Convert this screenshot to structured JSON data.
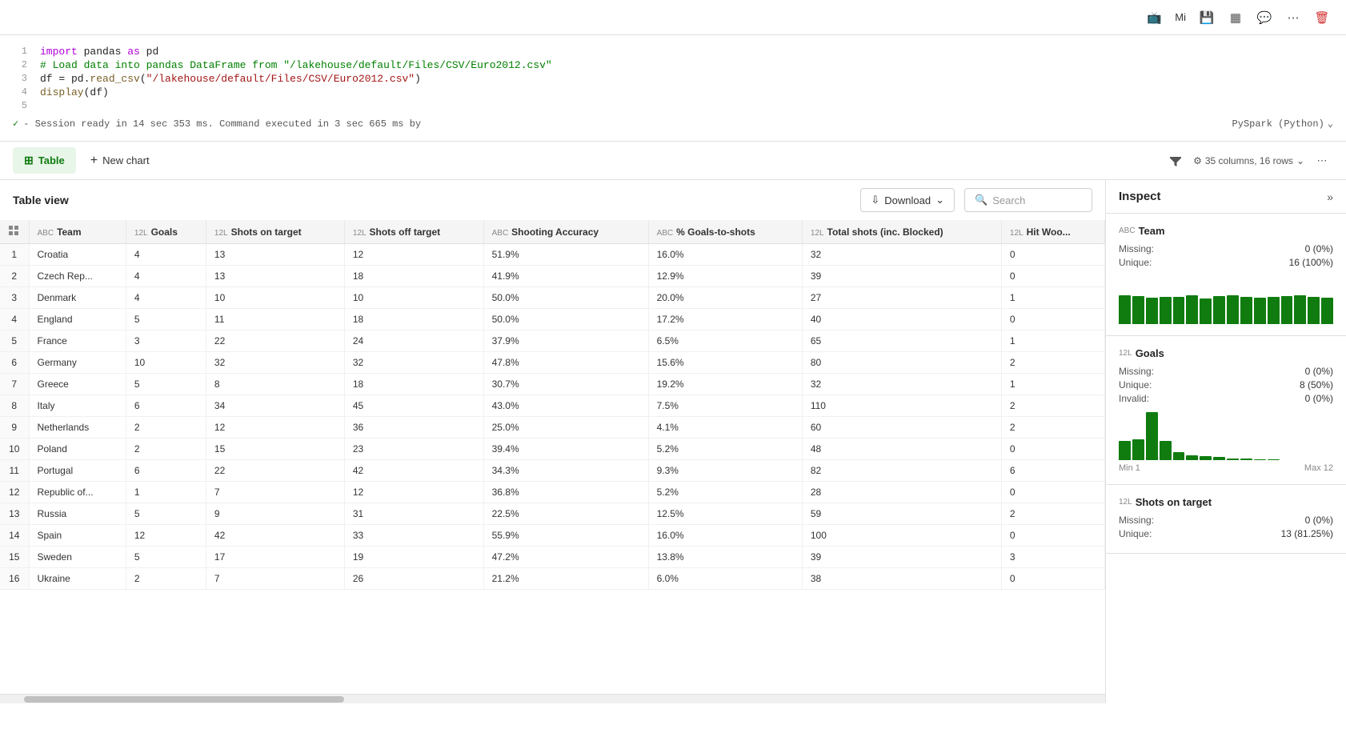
{
  "toolbar": {
    "user_label": "Mi",
    "icons": [
      "present-icon",
      "copy-icon",
      "comment-icon",
      "more-icon",
      "delete-icon"
    ]
  },
  "code": {
    "lines": [
      {
        "num": 1,
        "text": "import pandas as pd",
        "type": "import"
      },
      {
        "num": 2,
        "text": "# Load data into pandas DataFrame from \"/lakehouse/default/Files/CSV/Euro2012.csv\"",
        "type": "comment"
      },
      {
        "num": 3,
        "text": "df = pd.read_csv(\"/lakehouse/default/Files/CSV/Euro2012.csv\")",
        "type": "code"
      },
      {
        "num": 4,
        "text": "display(df)",
        "type": "code"
      },
      {
        "num": 5,
        "text": "",
        "type": "empty"
      }
    ],
    "status": "- Session ready in 14 sec 353 ms. Command executed in 3 sec 665 ms by",
    "pyspark_label": "PySpark (Python)"
  },
  "tabs": {
    "table_label": "Table",
    "new_chart_label": "New chart",
    "columns_info": "35 columns, 16 rows"
  },
  "table_view": {
    "title": "Table view",
    "download_label": "Download",
    "search_placeholder": "Search"
  },
  "columns": [
    {
      "name": "Team",
      "type": "ABC"
    },
    {
      "name": "Goals",
      "type": "12L"
    },
    {
      "name": "Shots on target",
      "type": "12L"
    },
    {
      "name": "Shots off target",
      "type": "12L"
    },
    {
      "name": "Shooting Accuracy",
      "type": "ABC"
    },
    {
      "name": "% Goals-to-shots",
      "type": "ABC"
    },
    {
      "name": "Total shots (inc. Blocked)",
      "type": "12L"
    },
    {
      "name": "Hit Woo...",
      "type": "12L"
    }
  ],
  "rows": [
    {
      "num": 1,
      "team": "Croatia",
      "goals": 4,
      "shots_on": 13,
      "shots_off": 12,
      "accuracy": "51.9%",
      "goals_to_shots": "16.0%",
      "total_shots": 32,
      "hit_woo": 0
    },
    {
      "num": 2,
      "team": "Czech Rep...",
      "goals": 4,
      "shots_on": 13,
      "shots_off": 18,
      "accuracy": "41.9%",
      "goals_to_shots": "12.9%",
      "total_shots": 39,
      "hit_woo": 0
    },
    {
      "num": 3,
      "team": "Denmark",
      "goals": 4,
      "shots_on": 10,
      "shots_off": 10,
      "accuracy": "50.0%",
      "goals_to_shots": "20.0%",
      "total_shots": 27,
      "hit_woo": 1
    },
    {
      "num": 4,
      "team": "England",
      "goals": 5,
      "shots_on": 11,
      "shots_off": 18,
      "accuracy": "50.0%",
      "goals_to_shots": "17.2%",
      "total_shots": 40,
      "hit_woo": 0
    },
    {
      "num": 5,
      "team": "France",
      "goals": 3,
      "shots_on": 22,
      "shots_off": 24,
      "accuracy": "37.9%",
      "goals_to_shots": "6.5%",
      "total_shots": 65,
      "hit_woo": 1
    },
    {
      "num": 6,
      "team": "Germany",
      "goals": 10,
      "shots_on": 32,
      "shots_off": 32,
      "accuracy": "47.8%",
      "goals_to_shots": "15.6%",
      "total_shots": 80,
      "hit_woo": 2
    },
    {
      "num": 7,
      "team": "Greece",
      "goals": 5,
      "shots_on": 8,
      "shots_off": 18,
      "accuracy": "30.7%",
      "goals_to_shots": "19.2%",
      "total_shots": 32,
      "hit_woo": 1
    },
    {
      "num": 8,
      "team": "Italy",
      "goals": 6,
      "shots_on": 34,
      "shots_off": 45,
      "accuracy": "43.0%",
      "goals_to_shots": "7.5%",
      "total_shots": 110,
      "hit_woo": 2
    },
    {
      "num": 9,
      "team": "Netherlands",
      "goals": 2,
      "shots_on": 12,
      "shots_off": 36,
      "accuracy": "25.0%",
      "goals_to_shots": "4.1%",
      "total_shots": 60,
      "hit_woo": 2
    },
    {
      "num": 10,
      "team": "Poland",
      "goals": 2,
      "shots_on": 15,
      "shots_off": 23,
      "accuracy": "39.4%",
      "goals_to_shots": "5.2%",
      "total_shots": 48,
      "hit_woo": 0
    },
    {
      "num": 11,
      "team": "Portugal",
      "goals": 6,
      "shots_on": 22,
      "shots_off": 42,
      "accuracy": "34.3%",
      "goals_to_shots": "9.3%",
      "total_shots": 82,
      "hit_woo": 6
    },
    {
      "num": 12,
      "team": "Republic of...",
      "goals": 1,
      "shots_on": 7,
      "shots_off": 12,
      "accuracy": "36.8%",
      "goals_to_shots": "5.2%",
      "total_shots": 28,
      "hit_woo": 0
    },
    {
      "num": 13,
      "team": "Russia",
      "goals": 5,
      "shots_on": 9,
      "shots_off": 31,
      "accuracy": "22.5%",
      "goals_to_shots": "12.5%",
      "total_shots": 59,
      "hit_woo": 2
    },
    {
      "num": 14,
      "team": "Spain",
      "goals": 12,
      "shots_on": 42,
      "shots_off": 33,
      "accuracy": "55.9%",
      "goals_to_shots": "16.0%",
      "total_shots": 100,
      "hit_woo": 0
    },
    {
      "num": 15,
      "team": "Sweden",
      "goals": 5,
      "shots_on": 17,
      "shots_off": 19,
      "accuracy": "47.2%",
      "goals_to_shots": "13.8%",
      "total_shots": 39,
      "hit_woo": 3
    },
    {
      "num": 16,
      "team": "Ukraine",
      "goals": 2,
      "shots_on": 7,
      "shots_off": 26,
      "accuracy": "21.2%",
      "goals_to_shots": "6.0%",
      "total_shots": 38,
      "hit_woo": 0
    }
  ],
  "inspect": {
    "title": "Inspect",
    "team_card": {
      "title": "Team",
      "type": "ABC",
      "missing": "0 (0%)",
      "unique": "16 (100%)",
      "bars": [
        60,
        58,
        55,
        57,
        56,
        60,
        54,
        58,
        60,
        57,
        55,
        56,
        58,
        60,
        57,
        55
      ]
    },
    "goals_card": {
      "title": "Goals",
      "type": "12L",
      "missing": "0 (0%)",
      "unique": "8 (50%)",
      "invalid": "0 (0%)",
      "min": "Min 1",
      "max": "Max 12",
      "bars": [
        20,
        22,
        50,
        20,
        8,
        5,
        4,
        3,
        2,
        2,
        1,
        1,
        0,
        0,
        0,
        0
      ]
    },
    "shots_card": {
      "title": "Shots on target",
      "type": "12L",
      "missing": "0 (0%)",
      "unique": "13 (81.25%)"
    }
  }
}
